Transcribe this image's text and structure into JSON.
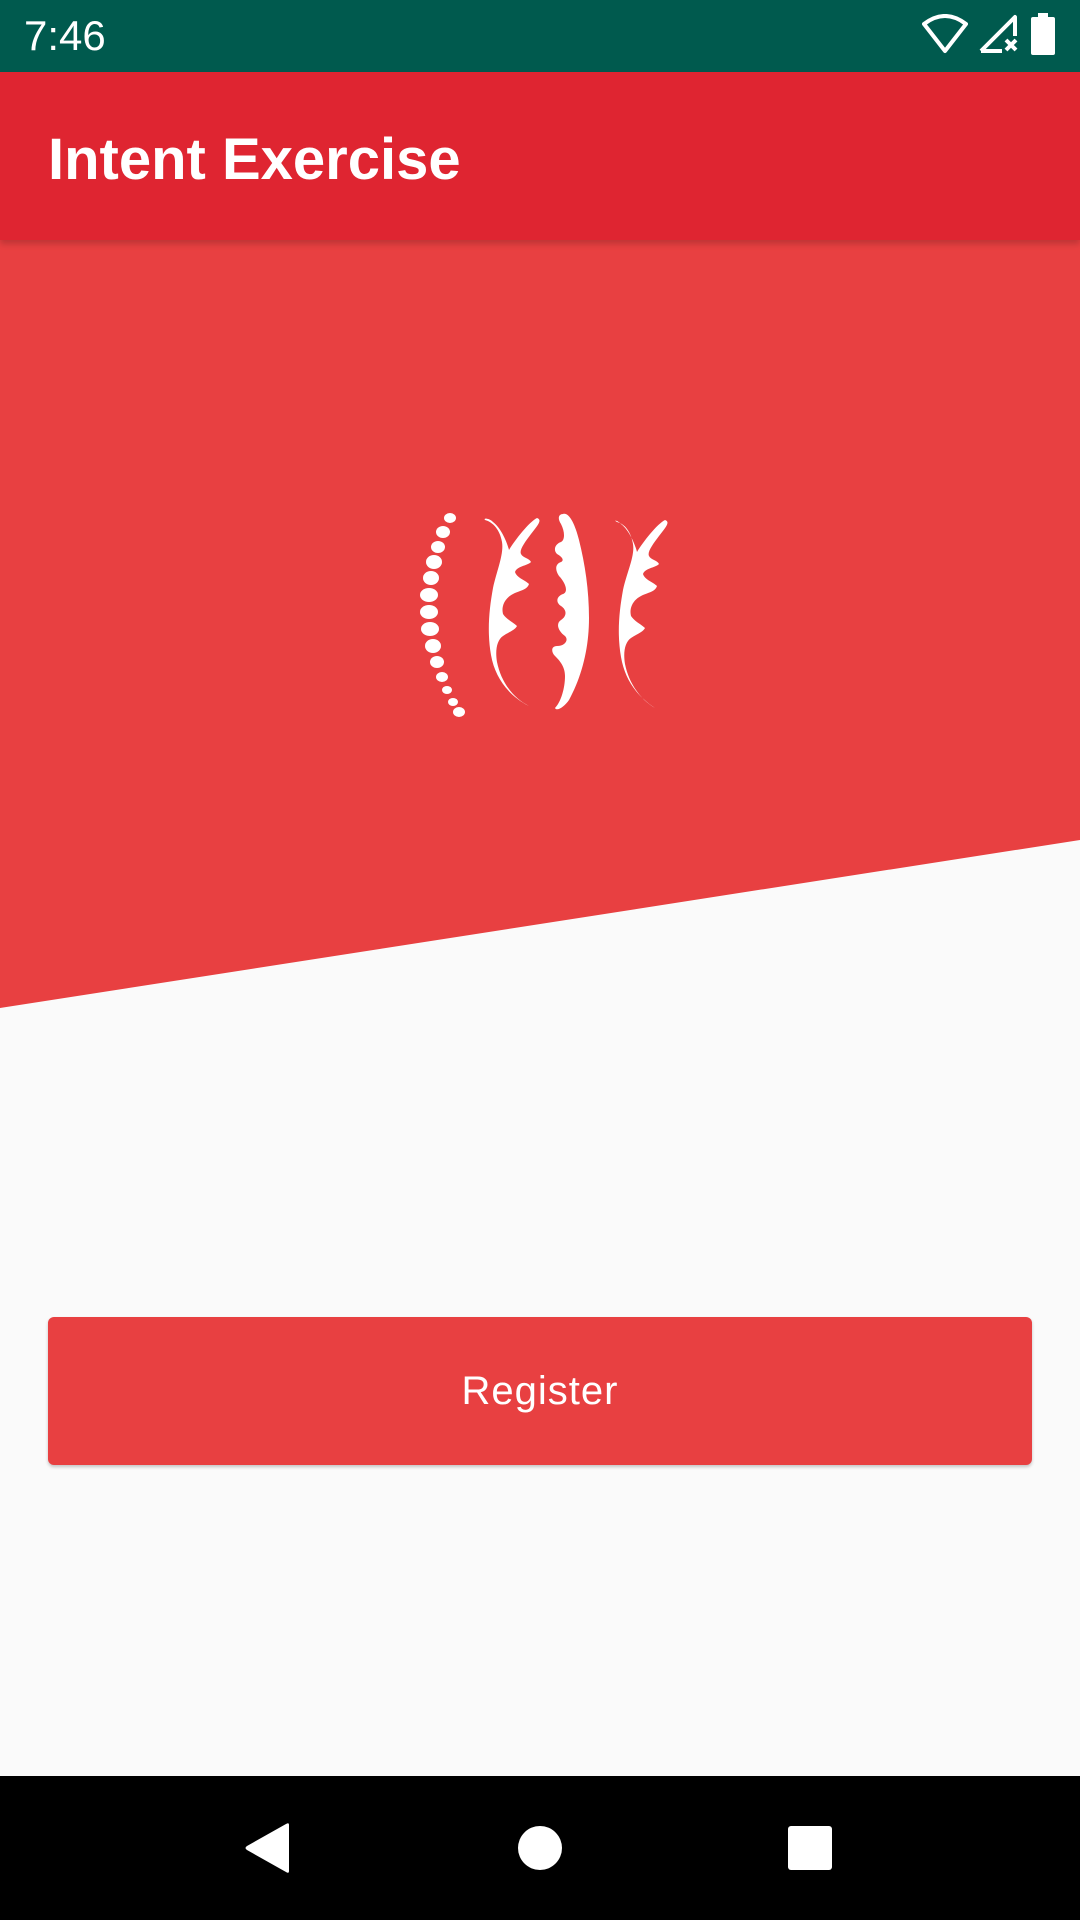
{
  "status_bar": {
    "time": "7:46",
    "icons": [
      "wifi-icon",
      "signal-no-service-icon",
      "battery-icon"
    ],
    "background": "#005a4e"
  },
  "app_bar": {
    "title": "Intent Exercise",
    "background": "#df2531"
  },
  "hero": {
    "background": "#e84041",
    "logo": "spine-logo-icon"
  },
  "main": {
    "register_label": "Register",
    "button_color": "#e84041"
  },
  "nav_bar": {
    "buttons": [
      "back-icon",
      "home-icon",
      "recents-icon"
    ]
  }
}
